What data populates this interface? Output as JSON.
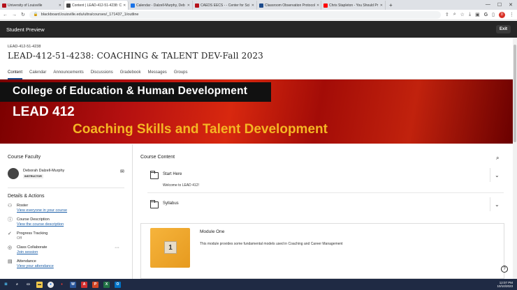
{
  "browser": {
    "tabs": [
      {
        "label": "University of Louisville",
        "color": "#b5121b"
      },
      {
        "label": "Content | LEAD-412-51-4238: C",
        "color": "#444444"
      },
      {
        "label": "Calendar - Dalzell-Murphy, Deb",
        "color": "#1a73e8"
      },
      {
        "label": "CAEDS EECS - - Center for Sci",
        "color": "#b5121b"
      },
      {
        "label": "Classroom Observation Protocol",
        "color": "#1c4a8a"
      },
      {
        "label": "Chris Stapleton - You Should Pr",
        "color": "#ff0000"
      }
    ],
    "url": "blackboard.louisville.edu/ultra/courses/_171437_1/outline"
  },
  "preview_bar": {
    "label": "Student Preview",
    "exit": "Exit"
  },
  "course": {
    "id": "LEAD-412-51-4238",
    "title": "LEAD-412-51-4238: COACHING & TALENT DEV-Fall 2023"
  },
  "nav_tabs": [
    "Content",
    "Calendar",
    "Announcements",
    "Discussions",
    "Gradebook",
    "Messages",
    "Groups"
  ],
  "banner": {
    "line1": "College of Education & Human Development",
    "line2": "LEAD 412",
    "line3": "Coaching Skills and Talent Development"
  },
  "faculty": {
    "heading": "Course Faculty",
    "name": "Deborah Dalzell-Murphy",
    "role": "INSTRUCTOR"
  },
  "details": {
    "heading": "Details & Actions",
    "items": [
      {
        "title": "Roster",
        "link": "View everyone in your course"
      },
      {
        "title": "Course Description",
        "link": "View the course description"
      },
      {
        "title": "Progress Tracking",
        "link": "Off"
      },
      {
        "title": "Class Collaborate",
        "link": "Join session"
      },
      {
        "title": "Attendance",
        "link": "View your attendance"
      }
    ]
  },
  "content": {
    "heading": "Course Content",
    "folders": [
      {
        "title": "Start Here",
        "desc": "Welcome to LEAD 412!"
      },
      {
        "title": "Syllabus",
        "desc": ""
      }
    ],
    "module": {
      "title": "Module One",
      "desc": "This module provides some fundamental models used in Coaching and Career Management",
      "number": "1"
    }
  },
  "taskbar": {
    "time": "12:07 PM",
    "date": "10/10/2023"
  }
}
